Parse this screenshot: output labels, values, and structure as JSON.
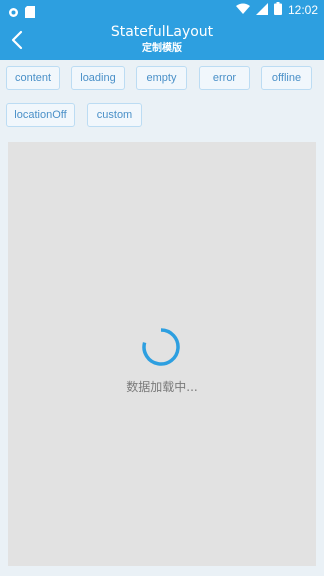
{
  "status_bar": {
    "time": "12:02"
  },
  "toolbar": {
    "title": "StatefulLayout",
    "subtitle": "定制模版"
  },
  "buttons": [
    {
      "label": "content"
    },
    {
      "label": "loading"
    },
    {
      "label": "empty"
    },
    {
      "label": "error"
    },
    {
      "label": "offline"
    },
    {
      "label": "locationOff"
    },
    {
      "label": "custom"
    }
  ],
  "content": {
    "loading_text": "数据加载中..."
  },
  "colors": {
    "primary": "#2d9fe0",
    "chip_text": "#4a90c8",
    "chip_border": "#bcdcf3"
  }
}
